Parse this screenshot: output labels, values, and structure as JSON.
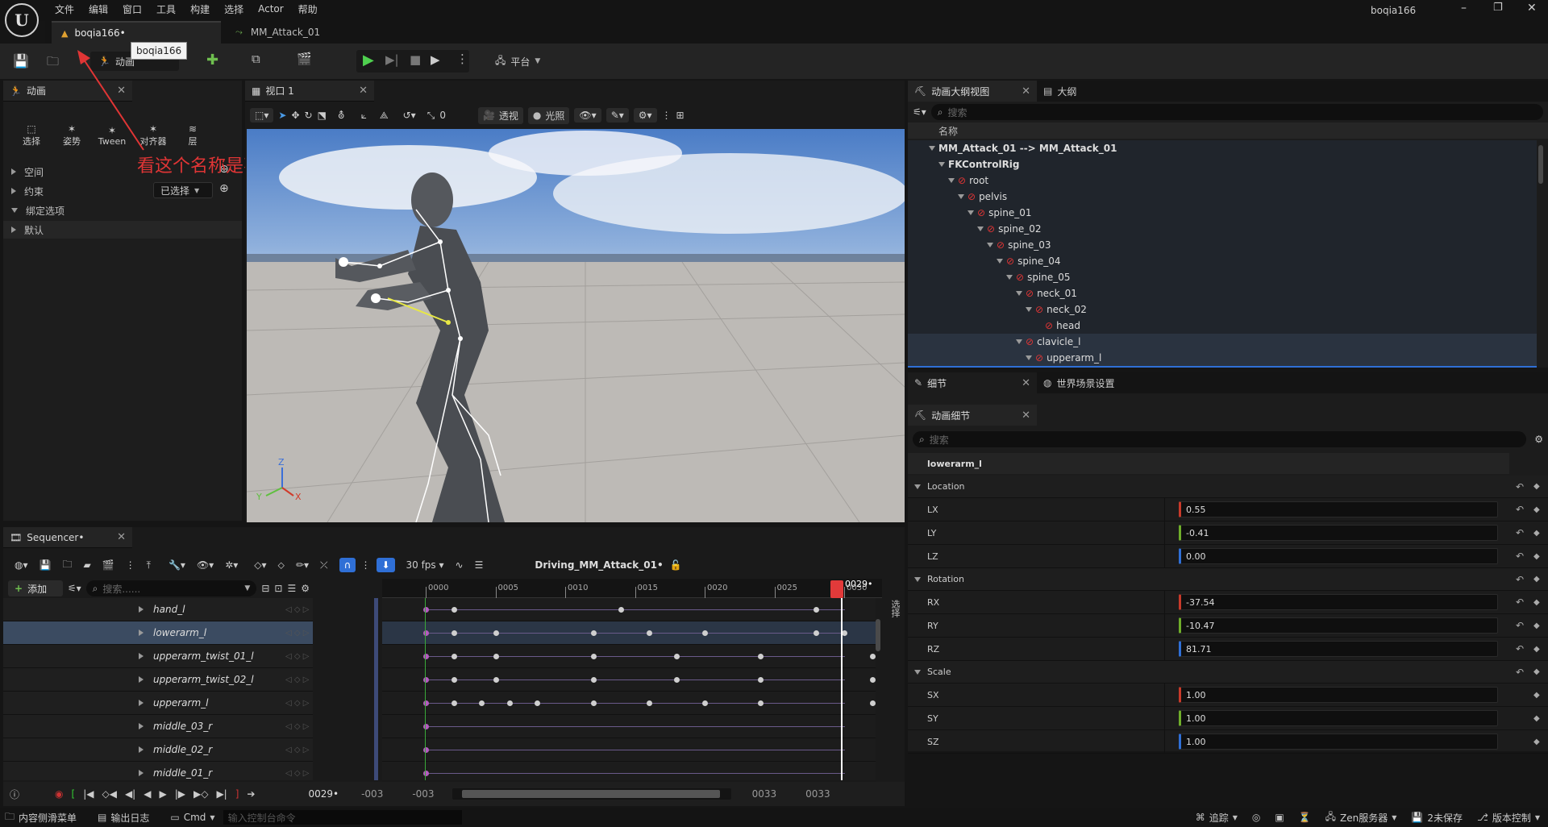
{
  "menubar": {
    "items": [
      "文件",
      "编辑",
      "窗口",
      "工具",
      "构建",
      "选择",
      "Actor",
      "帮助"
    ],
    "project": "boqia166"
  },
  "tabs": [
    {
      "label": "boqia166•"
    },
    {
      "label": "MM_Attack_01"
    }
  ],
  "tooltip": "boqia166",
  "toolbar": {
    "mode_label": "动画",
    "platform_label": "平台"
  },
  "annotation": "看这个名称是不是未命名或者unname",
  "anim_panel": {
    "title": "动画",
    "tools": [
      "选择",
      "姿势",
      "Tween",
      "对齐器",
      "层"
    ],
    "sections": [
      "空间",
      "约束",
      "绑定选项",
      "默认"
    ],
    "selected_label": "已选择"
  },
  "viewport": {
    "title": "视口 1",
    "perspective": "透视",
    "lighting": "光照",
    "snap_value": "0",
    "axes": {
      "z": "Z",
      "y": "Y",
      "x": "X"
    }
  },
  "outliner": {
    "tab1": "动画大纲视图",
    "tab2": "大纲",
    "search_placeholder": "搜索",
    "column": "名称",
    "tree": [
      {
        "label": "MM_Attack_01 --> MM_Attack_01",
        "depth": 0,
        "bold": true,
        "icon": false,
        "sel": false
      },
      {
        "label": "FKControlRig",
        "depth": 1,
        "bold": true,
        "icon": false,
        "sel": false
      },
      {
        "label": "root",
        "depth": 2,
        "bold": false,
        "icon": true,
        "sel": false
      },
      {
        "label": "pelvis",
        "depth": 3,
        "bold": false,
        "icon": true,
        "sel": false
      },
      {
        "label": "spine_01",
        "depth": 4,
        "bold": false,
        "icon": true,
        "sel": false
      },
      {
        "label": "spine_02",
        "depth": 5,
        "bold": false,
        "icon": true,
        "sel": false
      },
      {
        "label": "spine_03",
        "depth": 6,
        "bold": false,
        "icon": true,
        "sel": false
      },
      {
        "label": "spine_04",
        "depth": 7,
        "bold": false,
        "icon": true,
        "sel": false
      },
      {
        "label": "spine_05",
        "depth": 8,
        "bold": false,
        "icon": true,
        "sel": false
      },
      {
        "label": "neck_01",
        "depth": 9,
        "bold": false,
        "icon": true,
        "sel": false
      },
      {
        "label": "neck_02",
        "depth": 10,
        "bold": false,
        "icon": true,
        "sel": false
      },
      {
        "label": "head",
        "depth": 11,
        "bold": false,
        "icon": true,
        "sel": false
      },
      {
        "label": "clavicle_l",
        "depth": 9,
        "bold": false,
        "icon": true,
        "sel": true
      },
      {
        "label": "upperarm_l",
        "depth": 10,
        "bold": false,
        "icon": true,
        "sel": true
      }
    ]
  },
  "details": {
    "tab1": "细节",
    "tab2": "世界场景设置",
    "sub_tab": "动画细节",
    "search_placeholder": "搜索",
    "object": "lowerarm_l",
    "groups": [
      {
        "name": "Location",
        "fields": [
          {
            "label": "LX",
            "value": "0.55",
            "color": "#c83a2a"
          },
          {
            "label": "LY",
            "value": "-0.41",
            "color": "#6fae2a"
          },
          {
            "label": "LZ",
            "value": "0.00",
            "color": "#2f6fd6"
          }
        ]
      },
      {
        "name": "Rotation",
        "fields": [
          {
            "label": "RX",
            "value": "-37.54",
            "color": "#c83a2a"
          },
          {
            "label": "RY",
            "value": "-10.47",
            "color": "#6fae2a"
          },
          {
            "label": "RZ",
            "value": "81.71",
            "color": "#2f6fd6"
          }
        ]
      },
      {
        "name": "Scale",
        "fields": [
          {
            "label": "SX",
            "value": "1.00",
            "color": "#c83a2a"
          },
          {
            "label": "SY",
            "value": "1.00",
            "color": "#6fae2a"
          },
          {
            "label": "SZ",
            "value": "1.00",
            "color": "#2f6fd6"
          }
        ]
      }
    ]
  },
  "sequencer": {
    "title": "Sequencer•",
    "add_label": "添加",
    "search_placeholder": "搜索......",
    "fps": "30 fps",
    "sequence_name": "Driving_MM_Attack_01•",
    "playhead": "0029•",
    "ruler": [
      "0000",
      "0005",
      "0010",
      "0015",
      "0020",
      "0025",
      "0030"
    ],
    "tracks": [
      {
        "name": "hand_l",
        "selected": false,
        "keys": [
          0,
          2,
          14,
          28
        ]
      },
      {
        "name": "lowerarm_l",
        "selected": true,
        "keys": [
          0,
          2,
          5,
          12,
          16,
          20,
          28,
          30,
          48
        ]
      },
      {
        "name": "upperarm_twist_01_l",
        "selected": false,
        "keys": [
          0,
          2,
          5,
          12,
          18,
          24,
          32,
          40,
          48
        ]
      },
      {
        "name": "upperarm_twist_02_l",
        "selected": false,
        "keys": [
          0,
          2,
          5,
          12,
          18,
          24,
          32,
          40,
          48
        ]
      },
      {
        "name": "upperarm_l",
        "selected": false,
        "keys": [
          0,
          2,
          4,
          6,
          8,
          12,
          16,
          20,
          24,
          32,
          35,
          37,
          40,
          44,
          48
        ]
      },
      {
        "name": "middle_03_r",
        "selected": false,
        "keys": [
          0
        ]
      },
      {
        "name": "middle_02_r",
        "selected": false,
        "keys": [
          0
        ]
      },
      {
        "name": "middle_01_r",
        "selected": false,
        "keys": [
          0
        ]
      }
    ],
    "bottom": {
      "current": "0029•",
      "start1": "-003",
      "start2": "-003",
      "end1": "0033",
      "end2": "0033"
    },
    "side_label": "选择"
  },
  "statusbar": {
    "items": [
      "内容侧滑菜单",
      "输出日志",
      "Cmd"
    ],
    "console_placeholder": "输入控制台命令",
    "right": [
      "追踪",
      "Zen服务器",
      "2未保存",
      "版本控制"
    ]
  }
}
